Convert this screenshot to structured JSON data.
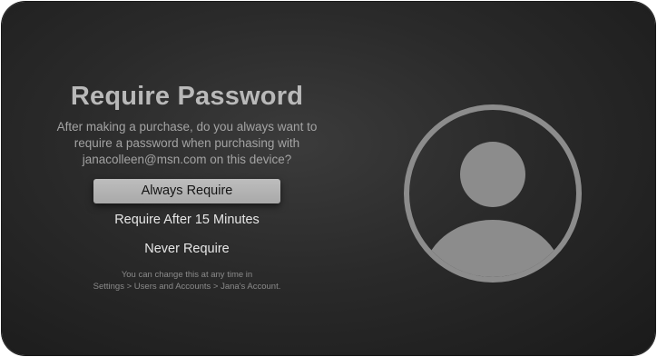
{
  "dialog": {
    "title": "Require Password",
    "question_lines": [
      "After making a purchase, do you always want to",
      "require a password when purchasing with",
      "janacolleen@msn.com on this device?"
    ],
    "options": [
      {
        "label": "Always Require",
        "selected": true
      },
      {
        "label": "Require After 15 Minutes",
        "selected": false
      },
      {
        "label": "Never Require",
        "selected": false
      }
    ],
    "footnote_lines": [
      "You can change this at any time in",
      "Settings > Users and Accounts > Jana's Account."
    ]
  },
  "icons": {
    "avatar": "user-silhouette-icon"
  },
  "colors": {
    "background": "#2a2a2a",
    "selected_option": "#b3b3b3",
    "avatar": "#8c8c8c"
  }
}
